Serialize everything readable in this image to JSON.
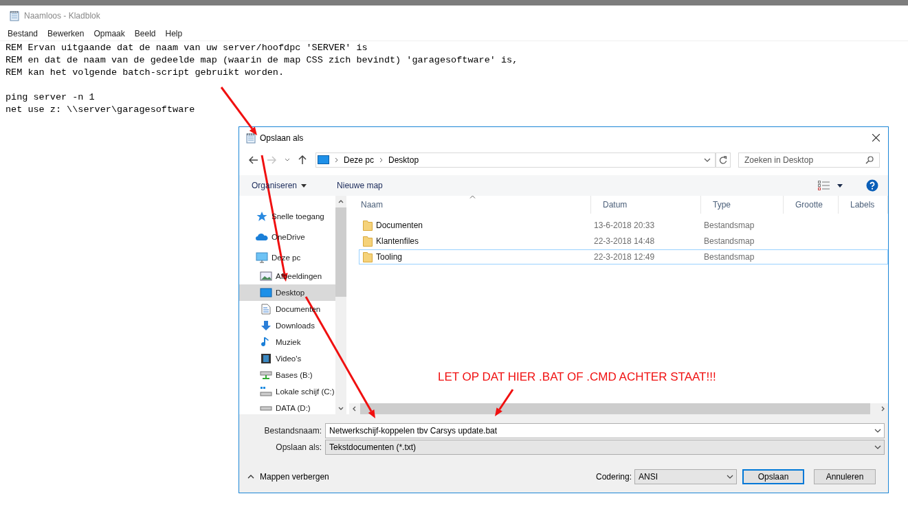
{
  "notepad": {
    "title": "Naamloos - Kladblok",
    "menu": [
      "Bestand",
      "Bewerken",
      "Opmaak",
      "Beeld",
      "Help"
    ],
    "text": "REM Ervan uitgaande dat de naam van uw server/hoofdpc 'SERVER' is\nREM en dat de naam van de gedeelde map (waarin de map CSS zich bevindt) 'garagesoftware' is,\nREM kan het volgende batch-script gebruikt worden.\n\nping server -n 1\nnet use z: \\\\server\\garagesoftware"
  },
  "dialog": {
    "title": "Opslaan als",
    "breadcrumb": [
      "Deze pc",
      "Desktop"
    ],
    "search": {
      "placeholder": "Zoeken in Desktop"
    },
    "toolbar": {
      "organize": "Organiseren",
      "new_folder": "Nieuwe map"
    },
    "sidebar": [
      {
        "label": "Snelle toegang",
        "kind": "star",
        "selected": false
      },
      {
        "label": "OneDrive",
        "kind": "cloud",
        "selected": false
      },
      {
        "label": "Deze pc",
        "kind": "pc",
        "selected": false,
        "children": [
          {
            "label": "Afbeeldingen",
            "kind": "pictures",
            "selected": false
          },
          {
            "label": "Desktop",
            "kind": "desktop",
            "selected": true
          },
          {
            "label": "Documenten",
            "kind": "document",
            "selected": false
          },
          {
            "label": "Downloads",
            "kind": "download",
            "selected": false
          },
          {
            "label": "Muziek",
            "kind": "music",
            "selected": false
          },
          {
            "label": "Video's",
            "kind": "video",
            "selected": false
          },
          {
            "label": "Bases (B:)",
            "kind": "netdrive",
            "selected": false
          },
          {
            "label": "Lokale schijf (C:)",
            "kind": "windrive",
            "selected": false
          },
          {
            "label": "DATA (D:)",
            "kind": "drive",
            "selected": false
          }
        ]
      }
    ],
    "columns": [
      "Naam",
      "Datum",
      "Type",
      "Grootte",
      "Labels"
    ],
    "rows": [
      {
        "name": "Documenten",
        "date": "13-6-2018 20:33",
        "type": "Bestandsmap",
        "selected": false
      },
      {
        "name": "Klantenfiles",
        "date": "22-3-2018 14:48",
        "type": "Bestandsmap",
        "selected": false
      },
      {
        "name": "Tooling",
        "date": "22-3-2018 12:49",
        "type": "Bestandsmap",
        "selected": true
      }
    ],
    "filename": {
      "label": "Bestandsnaam:",
      "value": "Netwerkschijf-koppelen tbv Carsys update.bat"
    },
    "save_type": {
      "label": "Opslaan als:",
      "value": "Tekstdocumenten (*.txt)"
    },
    "hide_folders": "Mappen verbergen",
    "encoding": {
      "label": "Codering:",
      "value": "ANSI"
    },
    "buttons": [
      {
        "label": "Opslaan",
        "default": true
      },
      {
        "label": "Annuleren",
        "default": false
      }
    ]
  },
  "annotation": "LET OP DAT HIER .BAT OF .CMD ACHTER STAAT!!!"
}
